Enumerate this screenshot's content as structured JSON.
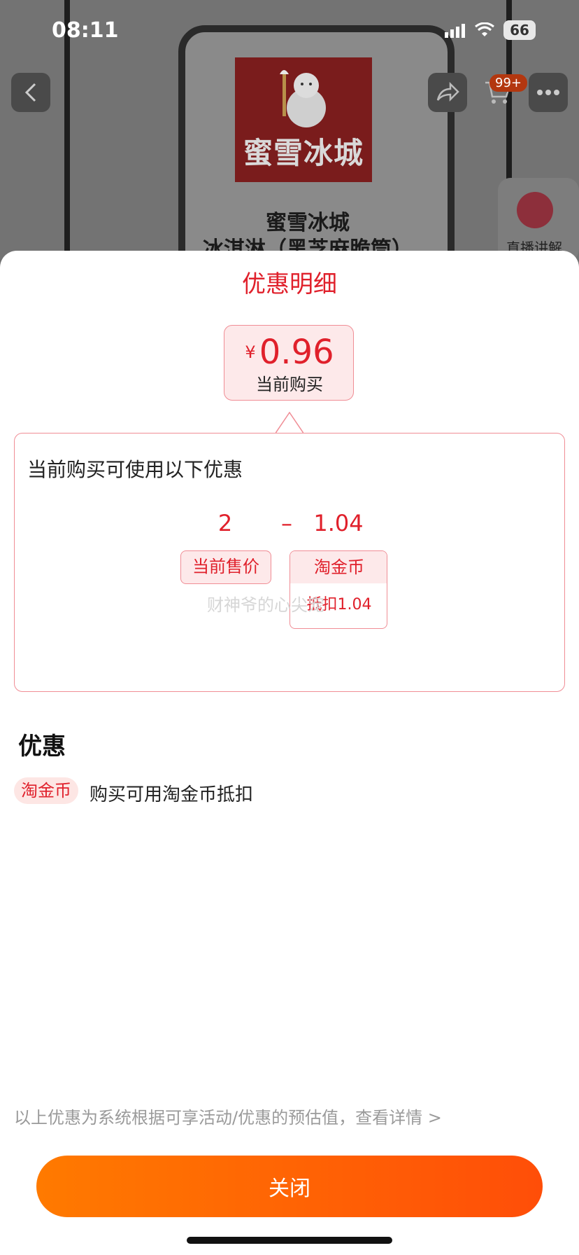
{
  "status_bar": {
    "time": "08:11",
    "battery": "66"
  },
  "background_page": {
    "brand_logo_text": "蜜雪冰城",
    "product_title_line1": "蜜雪冰城",
    "product_title_line2": "冰淇淋（黑芝麻脆筒）",
    "cart_badge": "99+",
    "live_label": "直播讲解"
  },
  "sheet": {
    "title": "优惠明细",
    "current_price": {
      "currency": "¥",
      "value": "0.96",
      "label": "当前购买"
    },
    "discount_box": {
      "heading": "当前购买可使用以下优惠",
      "original_value": "2",
      "operator": "–",
      "deduct_value": "1.04",
      "original_label": "当前售价",
      "coin_label": "淘金币",
      "coin_detail": "抵扣1.04",
      "watermark": "财神爷的心尖宠"
    },
    "section_title": "优惠",
    "coupon": {
      "tag": "淘金币",
      "description": "购买可用淘金币抵扣"
    },
    "footnote": "以上优惠为系统根据可享活动/优惠的预估值，查看详情 >",
    "close_button": "关闭"
  },
  "colors": {
    "accent": "#e0202b",
    "button_start": "#ff7a00",
    "button_end": "#ff4e08"
  }
}
